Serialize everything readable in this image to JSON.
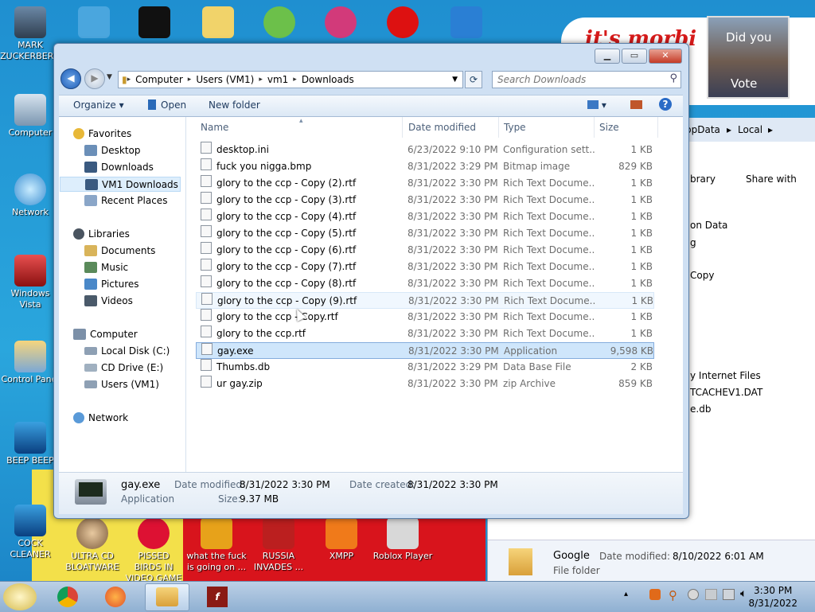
{
  "desktop": {
    "wallpaper_text": "it's morbi",
    "poster_text_1": "Did you",
    "poster_text_2": "Vote",
    "icons": [
      {
        "label": "MARK ZUCKERBERG"
      },
      {
        "label": "Computer"
      },
      {
        "label": "Network"
      },
      {
        "label": "Windows Vista"
      },
      {
        "label": "Control Panel"
      },
      {
        "label": "BEEP BEEP"
      },
      {
        "label": "COCK CLEANER"
      },
      {
        "label": "ULTRA CD BLOATWARE"
      },
      {
        "label": "PISSED BIRDS IN VIDEO GAME"
      },
      {
        "label": "what the fuck is going on ..."
      },
      {
        "label": "RUSSIA INVADES ..."
      },
      {
        "label": "XMPP"
      },
      {
        "label": "Roblox Player"
      }
    ]
  },
  "bg_window": {
    "path_1": "ppData",
    "path_2": "Local",
    "toolbar_1": "brary",
    "toolbar_2": "Share with",
    "items": [
      "on Data",
      "g",
      "Copy",
      "y Internet Files",
      "TCACHEV1.DAT",
      "e.db"
    ],
    "footer_name": "Google",
    "footer_date_label": "Date modified:",
    "footer_date": "8/10/2022 6:01 AM",
    "footer_type": "File folder"
  },
  "window": {
    "breadcrumb": [
      "Computer",
      "Users (VM1)",
      "vm1",
      "Downloads"
    ],
    "search_placeholder": "Search Downloads",
    "toolbar": {
      "organize": "Organize",
      "open": "Open",
      "new_folder": "New folder"
    },
    "columns": {
      "name": "Name",
      "date": "Date modified",
      "type": "Type",
      "size": "Size"
    },
    "nav": {
      "favorites": "Favorites",
      "desktop": "Desktop",
      "downloads": "Downloads",
      "vm1_downloads": "VM1 Downloads",
      "recent": "Recent Places",
      "libraries": "Libraries",
      "documents": "Documents",
      "music": "Music",
      "pictures": "Pictures",
      "videos": "Videos",
      "computer": "Computer",
      "local_disk": "Local Disk (C:)",
      "cd_drive": "CD Drive (E:)",
      "users": "Users (VM1)",
      "network": "Network"
    },
    "files": [
      {
        "name": "desktop.ini",
        "date": "6/23/2022 9:10 PM",
        "type": "Configuration sett...",
        "size": "1 KB"
      },
      {
        "name": "fuck you nigga.bmp",
        "date": "8/31/2022 3:29 PM",
        "type": "Bitmap image",
        "size": "829 KB"
      },
      {
        "name": "glory to the ccp - Copy (2).rtf",
        "date": "8/31/2022 3:30 PM",
        "type": "Rich Text Docume...",
        "size": "1 KB"
      },
      {
        "name": "glory to the ccp - Copy (3).rtf",
        "date": "8/31/2022 3:30 PM",
        "type": "Rich Text Docume...",
        "size": "1 KB"
      },
      {
        "name": "glory to the ccp - Copy (4).rtf",
        "date": "8/31/2022 3:30 PM",
        "type": "Rich Text Docume...",
        "size": "1 KB"
      },
      {
        "name": "glory to the ccp - Copy (5).rtf",
        "date": "8/31/2022 3:30 PM",
        "type": "Rich Text Docume...",
        "size": "1 KB"
      },
      {
        "name": "glory to the ccp - Copy (6).rtf",
        "date": "8/31/2022 3:30 PM",
        "type": "Rich Text Docume...",
        "size": "1 KB"
      },
      {
        "name": "glory to the ccp - Copy (7).rtf",
        "date": "8/31/2022 3:30 PM",
        "type": "Rich Text Docume...",
        "size": "1 KB"
      },
      {
        "name": "glory to the ccp - Copy (8).rtf",
        "date": "8/31/2022 3:30 PM",
        "type": "Rich Text Docume...",
        "size": "1 KB"
      },
      {
        "name": "glory to the ccp - Copy (9).rtf",
        "date": "8/31/2022 3:30 PM",
        "type": "Rich Text Docume...",
        "size": "1 KB"
      },
      {
        "name": "glory to the ccp - Copy.rtf",
        "date": "8/31/2022 3:30 PM",
        "type": "Rich Text Docume...",
        "size": "1 KB"
      },
      {
        "name": "glory to the ccp.rtf",
        "date": "8/31/2022 3:30 PM",
        "type": "Rich Text Docume...",
        "size": "1 KB"
      },
      {
        "name": "gay.exe",
        "date": "8/31/2022 3:30 PM",
        "type": "Application",
        "size": "9,598 KB"
      },
      {
        "name": "Thumbs.db",
        "date": "8/31/2022 3:29 PM",
        "type": "Data Base File",
        "size": "2 KB"
      },
      {
        "name": "ur gay.zip",
        "date": "8/31/2022 3:30 PM",
        "type": "zip Archive",
        "size": "859 KB"
      }
    ],
    "details": {
      "name": "gay.exe",
      "type": "Application",
      "modified_label": "Date modified:",
      "modified": "8/31/2022 3:30 PM",
      "created_label": "Date created:",
      "created": "8/31/2022 3:30 PM",
      "size_label": "Size:",
      "size": "9.37 MB"
    }
  },
  "taskbar": {
    "time": "3:30 PM",
    "date": "8/31/2022"
  }
}
